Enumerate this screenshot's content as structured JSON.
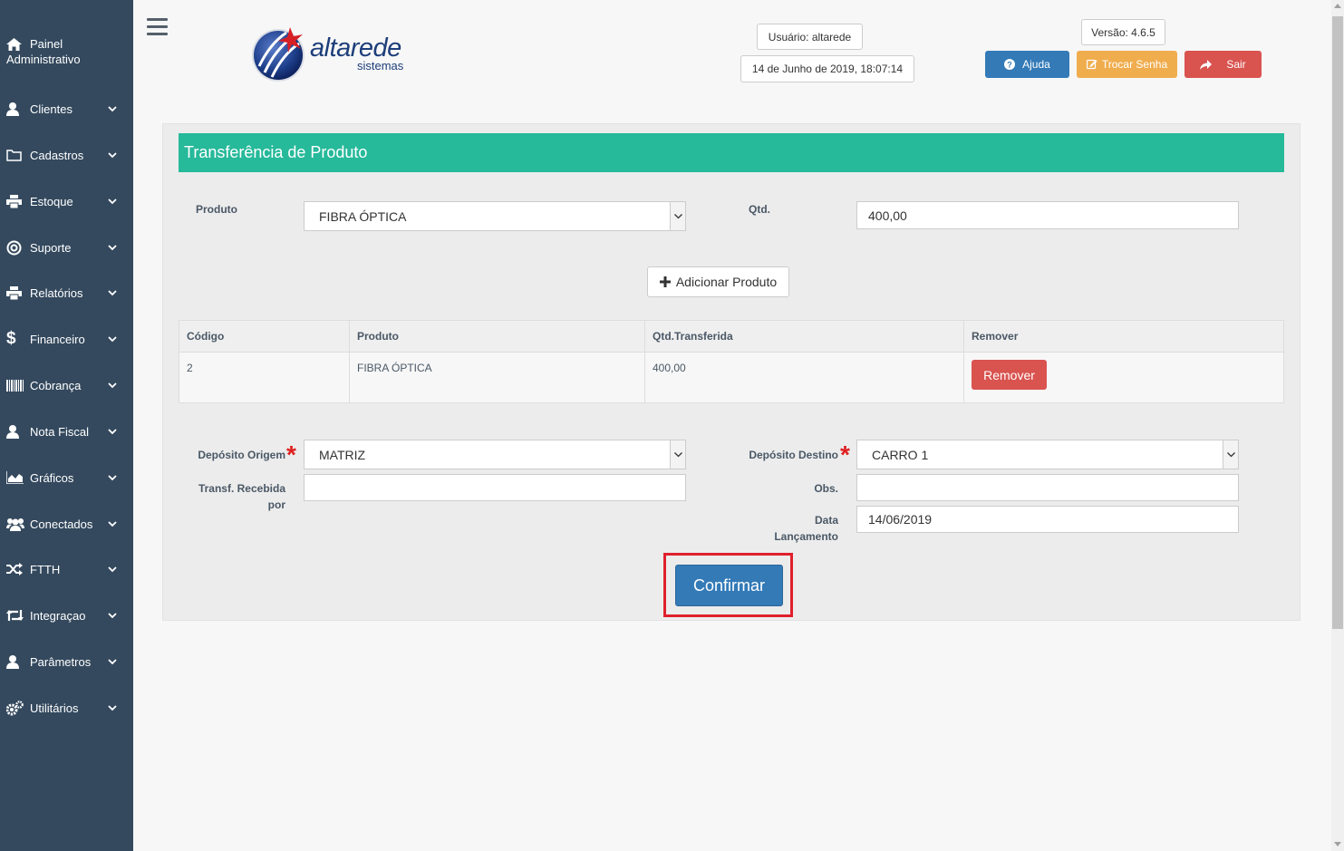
{
  "sidebar": {
    "title_line1": "Painel",
    "title_line2": "Administrativo",
    "items": [
      {
        "label": "Clientes",
        "icon": "user-icon"
      },
      {
        "label": "Cadastros",
        "icon": "folder-icon"
      },
      {
        "label": "Estoque",
        "icon": "printer-icon"
      },
      {
        "label": "Suporte",
        "icon": "lifebuoy-icon"
      },
      {
        "label": "Relatórios",
        "icon": "printer-icon"
      },
      {
        "label": "Financeiro",
        "icon": "dollar-icon"
      },
      {
        "label": "Cobrança",
        "icon": "barcode-icon"
      },
      {
        "label": "Nota Fiscal",
        "icon": "user-icon"
      },
      {
        "label": "Gráficos",
        "icon": "area-chart-icon"
      },
      {
        "label": "Conectados",
        "icon": "users-icon"
      },
      {
        "label": "FTTH",
        "icon": "random-icon"
      },
      {
        "label": "Integraçao",
        "icon": "retweet-icon"
      },
      {
        "label": "Parâmetros",
        "icon": "user-icon"
      },
      {
        "label": "Utilitários",
        "icon": "cogs-icon"
      }
    ]
  },
  "header": {
    "logo_text": "altarede",
    "logo_sub": "sistemas",
    "user": "Usuário: altarede",
    "datetime": "14 de Junho de 2019, 18:07:14",
    "version": "Versão: 4.6.5",
    "help_label": "Ajuda",
    "change_password_label": "Trocar Senha",
    "logout_label": "Sair",
    "colors": {
      "help": "#337ab7",
      "change_password": "#f0ad4e",
      "logout": "#d9534f"
    }
  },
  "form": {
    "title": "Transferência de Produto",
    "product_label": "Produto",
    "product_value": "FIBRA ÓPTICA",
    "qty_label": "Qtd.",
    "qty_value": "400,00",
    "add_product_label": "Adicionar Produto",
    "table": {
      "headers": [
        "Código",
        "Produto",
        "Qtd.Transferida",
        "Remover"
      ],
      "rows": [
        {
          "codigo": "2",
          "produto": "FIBRA ÓPTICA",
          "qtd": "400,00",
          "remove_label": "Remover"
        }
      ]
    },
    "origin_label": "Depósito Origem",
    "origin_value": "MATRIZ",
    "destination_label": "Depósito Destino",
    "destination_value": "CARRO 1",
    "received_by_label_1": "Transf. Recebida",
    "received_by_label_2": "por",
    "received_by_value": "",
    "obs_label": "Obs.",
    "obs_value": "",
    "date_label_1": "Data",
    "date_label_2": "Lançamento",
    "date_value": "14/06/2019",
    "confirm_label": "Confirmar",
    "accent_color": "#26b99a"
  }
}
